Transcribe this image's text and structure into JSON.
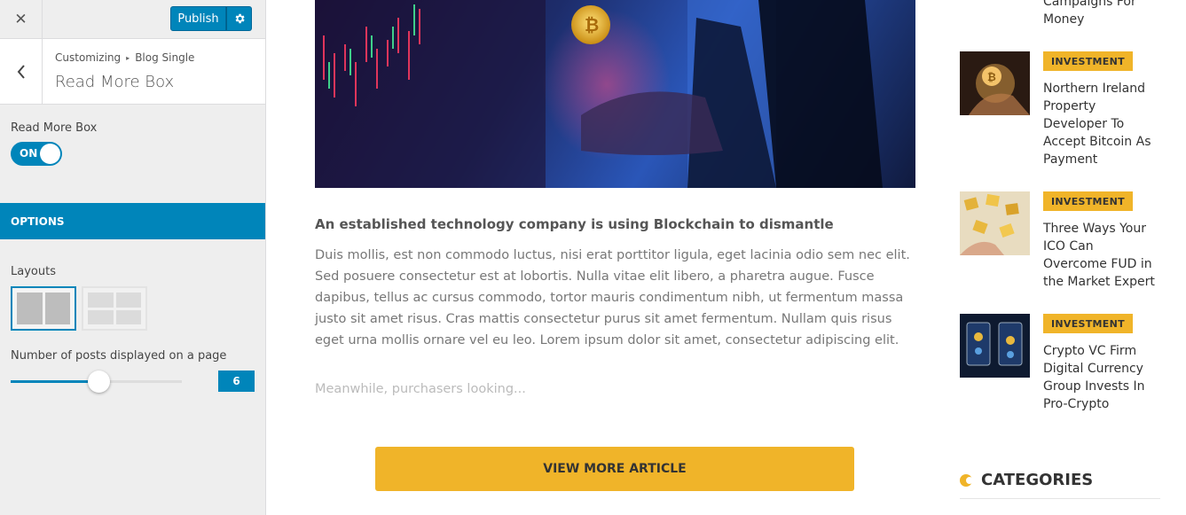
{
  "customizer": {
    "publish_label": "Publish",
    "breadcrumb": [
      "Customizing",
      "Blog Single"
    ],
    "section_title": "Read More Box",
    "read_more_label": "Read More Box",
    "toggle_label": "ON",
    "toggle_on": true,
    "options_header": "OPTIONS",
    "layouts_label": "Layouts",
    "posts_label": "Number of posts displayed on a page",
    "posts_value": "6",
    "accent_color": "#0085ba",
    "icons": {
      "close": "close-icon",
      "settings": "gear-icon",
      "back": "chevron-left-icon"
    }
  },
  "article": {
    "lead": "An established technology company is using Blockchain to dismantle",
    "body": "Duis mollis, est non commodo luctus, nisi erat porttitor ligula, eget lacinia odio sem nec elit. Sed posuere consectetur est at lobortis. Nulla vitae elit libero, a pharetra augue. Fusce dapibus, tellus ac cursus commodo, tortor mauris condimentum nibh, ut fermentum massa justo sit amet risus. Cras mattis consectetur purus sit amet fermentum. Nullam quis risus eget urna mollis ornare vel eu leo. Lorem ipsum dolor sit amet, consectetur adipiscing elit.",
    "faded": "Meanwhile, purchasers looking...",
    "button_label": "VIEW MORE ARTICLE",
    "button_color": "#f0b429"
  },
  "sidebar": {
    "cut_title": "Campaigns For Money",
    "items": [
      {
        "badge": "INVESTMENT",
        "title": "Northern Ireland Property Developer To Accept Bitcoin As Payment"
      },
      {
        "badge": "INVESTMENT",
        "title": "Three Ways Your ICO Can Overcome FUD in the Market Expert"
      },
      {
        "badge": "INVESTMENT",
        "title": "Crypto VC Firm Digital Currency Group Invests In Pro-Crypto"
      }
    ],
    "categories_title": "CATEGORIES"
  }
}
